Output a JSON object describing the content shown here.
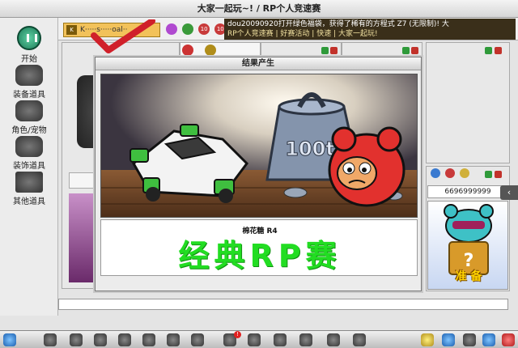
{
  "window": {
    "title": "大家一起玩~! / RP个人竞速赛",
    "close_glyph": "✕"
  },
  "sidebar": {
    "items": [
      {
        "label": "开始",
        "icon": "play-pause-icon"
      },
      {
        "label": "装备道具",
        "icon": "helmet-icon"
      },
      {
        "label": "角色/宠物",
        "icon": "character-icon"
      },
      {
        "label": "装饰道具",
        "icon": "hand-decoration-icon"
      },
      {
        "label": "其他道具",
        "icon": "crate-icon"
      }
    ]
  },
  "topbar": {
    "player_level": "K",
    "player_name": "K·····s·····oal··",
    "stat_badges": [
      "10",
      "10",
      "10"
    ],
    "news_line1": "dou20090920打开绿色福袋，获得了稀有的方程式 Z7 (无限制)! 大",
    "news_line2": "RP个人竞速赛 | 好赛活动 | 快速 | 大家一起玩!"
  },
  "dialog": {
    "title": "结果产生",
    "scene_weight_label": "100t",
    "kart_name": "棉花糖 R4",
    "caption": "经典RP赛"
  },
  "right_panel": {
    "score": "6696999999",
    "ready_label": "准 备"
  },
  "colors": {
    "caption_green": "#22dd22",
    "ready_yellow": "#ffd200",
    "player_chip": "#f2c25a",
    "check_red": "#d0202a"
  }
}
